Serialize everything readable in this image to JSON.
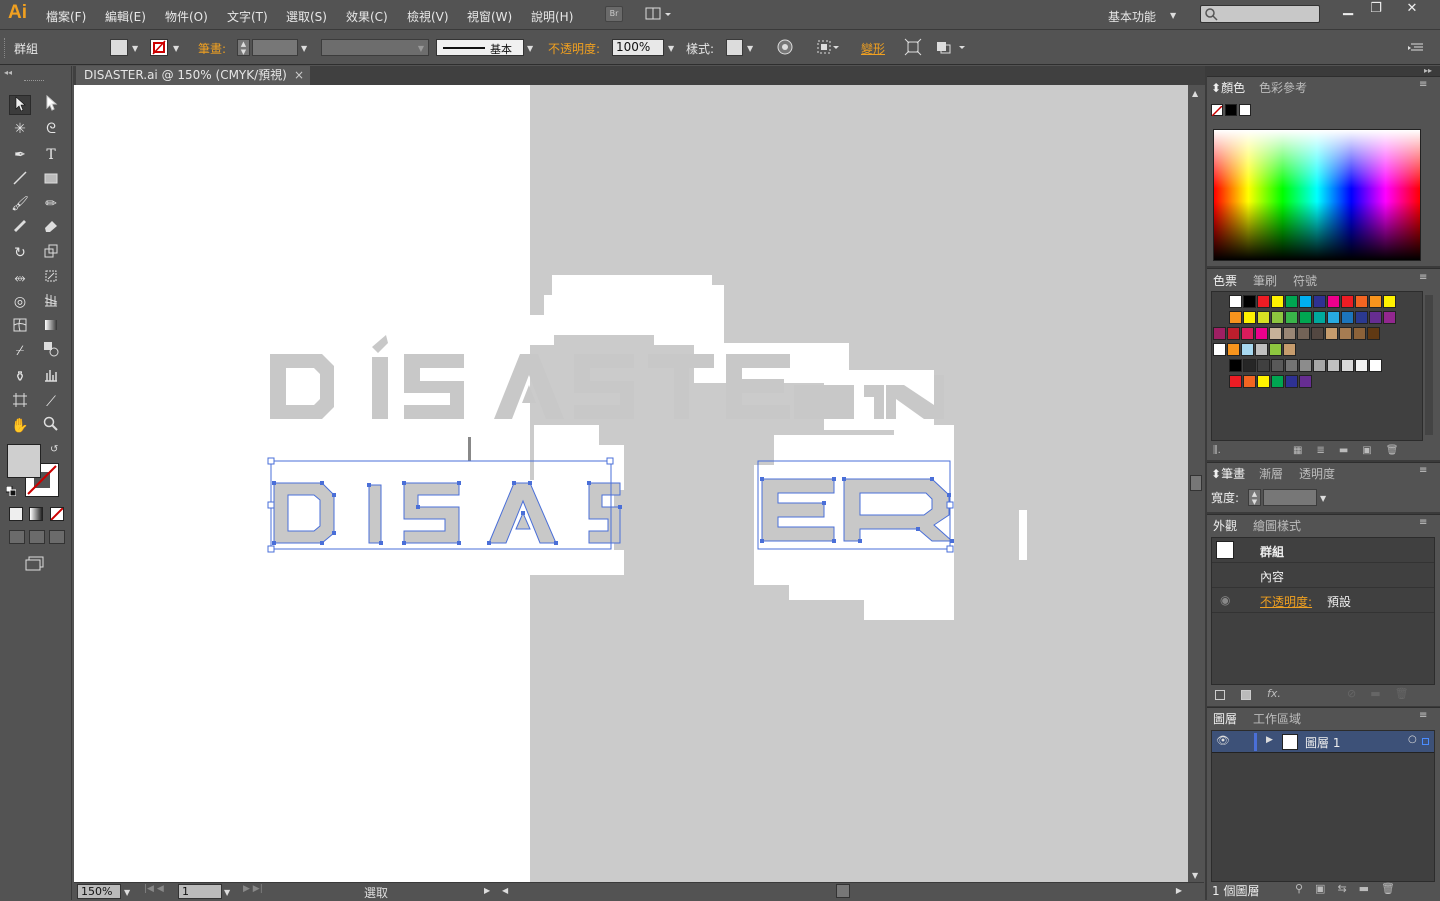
{
  "app": {
    "logo": "Ai"
  },
  "menu": [
    {
      "label": "檔案(F)"
    },
    {
      "label": "編輯(E)"
    },
    {
      "label": "物件(O)"
    },
    {
      "label": "文字(T)"
    },
    {
      "label": "選取(S)"
    },
    {
      "label": "效果(C)"
    },
    {
      "label": "檢視(V)"
    },
    {
      "label": "視窗(W)"
    },
    {
      "label": "說明(H)"
    }
  ],
  "workspace": {
    "label": "基本功能"
  },
  "bridge": {
    "label": "Br"
  },
  "control": {
    "selection_label": "群組",
    "stroke_label": "筆畫:",
    "stroke_style": "基本",
    "opacity_label": "不透明度:",
    "opacity_value": "100%",
    "style_label": "樣式:",
    "transform_label": "變形"
  },
  "document": {
    "tab_title": "DISASTER.ai @ 150% (CMYK/預視)",
    "close": "×"
  },
  "artwork": {
    "title_outline": "DISASTER"
  },
  "status": {
    "zoom": "150%",
    "page": "1",
    "tool": "選取"
  },
  "panels": {
    "color": {
      "tabs": [
        "顏色",
        "色彩參考"
      ]
    },
    "swatches": {
      "tabs": [
        "色票",
        "筆刷",
        "符號"
      ]
    },
    "stroke": {
      "tabs": [
        "筆畫",
        "漸層",
        "透明度"
      ],
      "width_label": "寬度:"
    },
    "appearance": {
      "tabs": [
        "外觀",
        "繪圖樣式"
      ],
      "group_label": "群組",
      "content_label": "內容",
      "opacity_label": "不透明度:",
      "opacity_value": "預設",
      "fx_label": "fx."
    },
    "layers": {
      "tabs": [
        "圖層",
        "工作區域"
      ],
      "layer_name": "圖層 1",
      "count_label": "1 個圖層"
    }
  },
  "colors": {
    "accent": "#f0a020",
    "ui_bg": "#535353",
    "selection": "#4a6fd8",
    "art_gray": "#cbcbcb"
  },
  "swatch_colors": [
    [
      "#ffffff",
      "#000000",
      "#ed1c24",
      "#fff200",
      "#00a651",
      "#00aeef",
      "#2e3192",
      "#ec008c",
      "#ed1c24",
      "#f26522",
      "#f7941d",
      "#fff200"
    ],
    [
      "#f7941d",
      "#fff200",
      "#d7df23",
      "#8dc63f",
      "#39b54a",
      "#00a651",
      "#00a99d",
      "#27aae1",
      "#1c75bc",
      "#2b3990",
      "#662d91",
      "#92278f"
    ],
    [
      "#9e1f63",
      "#be1e2d",
      "#da1c5c",
      "#ec008c",
      "#c7b299",
      "#998675",
      "#736357",
      "#534741",
      "#c69c6d",
      "#a67c52",
      "#8c6239",
      "#603913"
    ],
    [
      "#ffffff",
      "#f7941d",
      "#a7d8f0",
      "#c0c0c0",
      "#8dc63f",
      "#c69c6d"
    ],
    [
      "#000000",
      "#262626",
      "#404040",
      "#595959",
      "#737373",
      "#8c8c8c",
      "#a6a6a6",
      "#bfbfbf",
      "#d9d9d9",
      "#f2f2f2",
      "#ffffff"
    ],
    [
      "#ed1c24",
      "#f26522",
      "#fff200",
      "#00a651",
      "#2e3192",
      "#662d91"
    ]
  ]
}
